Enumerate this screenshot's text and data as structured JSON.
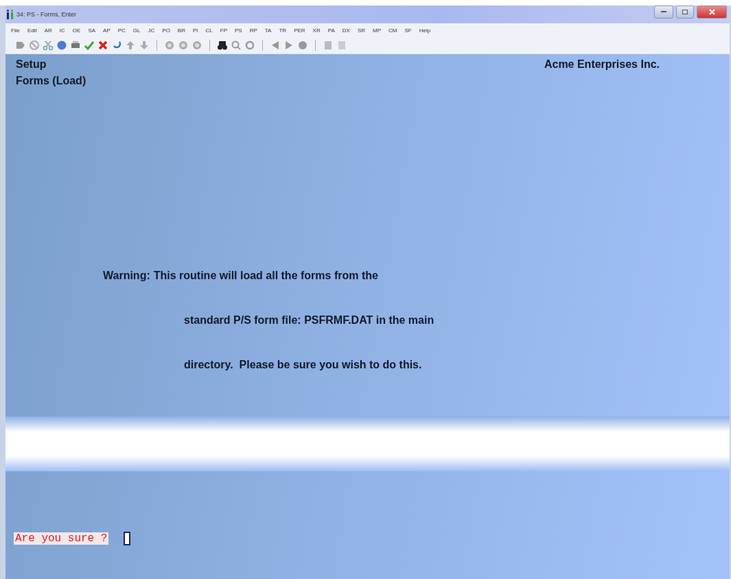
{
  "window": {
    "title": "34: PS - Forms, Enter"
  },
  "menu": [
    "File",
    "Edit",
    "AR",
    "IC",
    "OE",
    "SA",
    "AP",
    "PC",
    "GL",
    "JC",
    "PO",
    "BR",
    "PI",
    "CL",
    "FP",
    "PS",
    "RP",
    "TA",
    "TR",
    "PER",
    "XR",
    "PA",
    "DX",
    "SR",
    "MP",
    "CM",
    "SF",
    "Help"
  ],
  "header": {
    "module": "Setup",
    "company": "Acme Enterprises Inc.",
    "screen": "Forms (Load)"
  },
  "warning": {
    "lead": "Warning:",
    "lines": [
      "This routine will load all the forms from the",
      "standard P/S form file: PSFRMF.DAT in the main",
      "directory.  Please be sure you wish to do this."
    ]
  },
  "prompt": {
    "label": "Are you sure ?"
  }
}
